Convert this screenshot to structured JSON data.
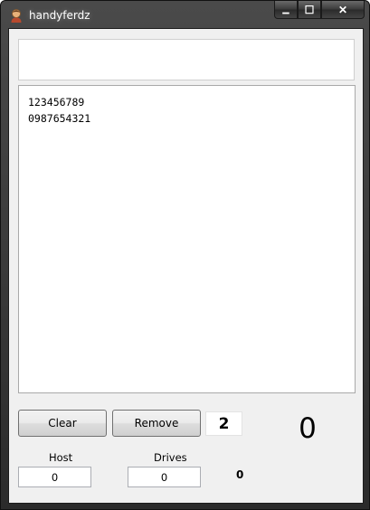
{
  "window": {
    "title": "handyferdz",
    "minimize_icon": "minimize-icon",
    "maximize_icon": "maximize-icon",
    "close_icon": "close-icon",
    "minimize_glyph": "▁",
    "maximize_glyph": "☐",
    "close_glyph": "✕"
  },
  "top_input": {
    "value": ""
  },
  "list": {
    "items": [
      "123456789",
      "0987654321"
    ]
  },
  "buttons": {
    "clear_label": "Clear",
    "remove_label": "Remove"
  },
  "count": {
    "value": "2"
  },
  "big_number": {
    "value": "0"
  },
  "host": {
    "label": "Host",
    "value": "0"
  },
  "drives": {
    "label": "Drives",
    "value": "0"
  },
  "small_value": {
    "value": "0"
  }
}
